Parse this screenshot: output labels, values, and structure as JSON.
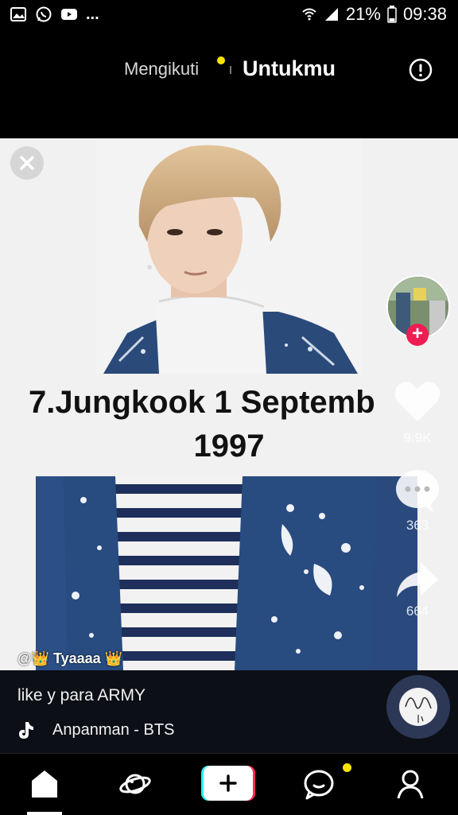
{
  "status_bar": {
    "notification_icons": [
      "gallery-icon",
      "whatsapp-icon",
      "youtube-icon"
    ],
    "more": "...",
    "battery": "21%",
    "time": "09:38"
  },
  "top_nav": {
    "following": "Mengikuti",
    "for_you": "Untukmu",
    "accent_dot_color": "#f7e400"
  },
  "video": {
    "title_line1": "7.Jungkook 1 Septemb",
    "title_line2": "1997",
    "credit": "@👑 Tyaaaa 👑",
    "likes": "9.9K",
    "comments": "363",
    "shares": "664"
  },
  "caption": {
    "text": "like y para ARMY",
    "music": "Anpanman - BTS"
  },
  "colors": {
    "follow_plus": "#ee1d52",
    "create_left": "#25f4ee",
    "create_right": "#fe2c55"
  }
}
